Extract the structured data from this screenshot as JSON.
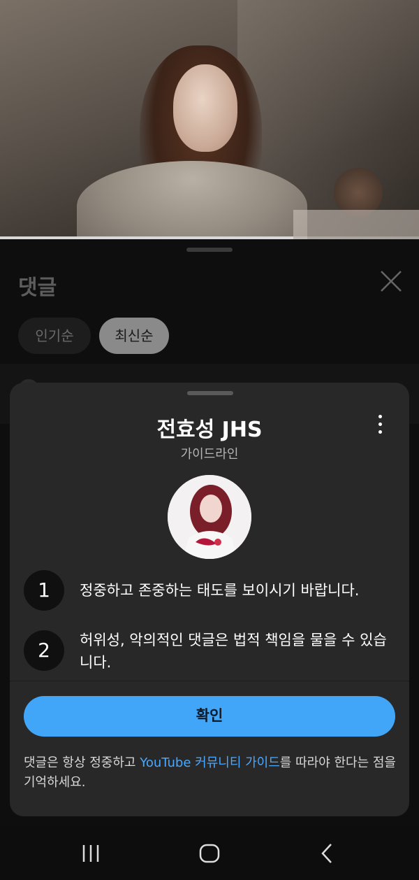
{
  "video": {
    "progress_fraction": 0.7
  },
  "comments": {
    "title": "댓글",
    "sort_chips": [
      {
        "label": "인기순",
        "selected": false
      },
      {
        "label": "최신순",
        "selected": true
      }
    ]
  },
  "guideline": {
    "channel_name": "전효성 JHS",
    "subtitle": "가이드라인",
    "rules": [
      {
        "num": "1",
        "text": "정중하고 존중하는 태도를 보이시기 바랍니다."
      },
      {
        "num": "2",
        "text": "허위성, 악의적인 댓글은 법적 책임을 물을 수 있습니다."
      }
    ],
    "confirm_label": "확인",
    "footer": {
      "prefix": "댓글은 항상 정중하고 ",
      "link": "YouTube 커뮤니티 가이드",
      "suffix": "를 따라야 한다는 점을 기억하세요."
    }
  },
  "colors": {
    "accent": "#41a6f8",
    "link": "#4aa8ff",
    "sheet_bg": "#282828"
  },
  "icons": {
    "close": "close-icon",
    "more": "more-vert-icon",
    "nav": [
      "recent-apps-icon",
      "home-icon",
      "back-icon"
    ]
  }
}
